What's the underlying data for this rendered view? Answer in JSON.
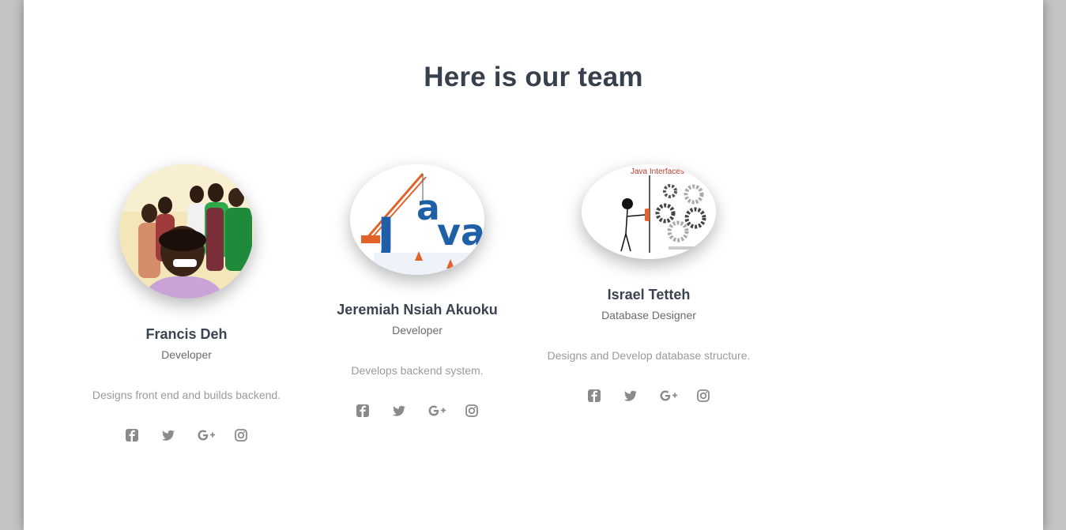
{
  "section": {
    "title": "Here is our team"
  },
  "team": [
    {
      "name": "Francis Deh",
      "role": "Developer",
      "description": "Designs front end and builds backend.",
      "photo": "group-photo"
    },
    {
      "name": "Jeremiah Nsiah Akuoku",
      "role": "Developer",
      "description": "Develops backend system.",
      "photo": "java-logo-image"
    },
    {
      "name": "Israel Tetteh",
      "role": "Database Designer",
      "description": "Designs and Develop database structure.",
      "photo": "java-interfaces-image",
      "photo_caption": "Java Interfaces"
    }
  ],
  "social_icons": [
    "facebook-icon",
    "twitter-icon",
    "google-plus-icon",
    "instagram-icon"
  ],
  "colors": {
    "heading": "#37414e",
    "icon": "#8a8a8a",
    "java_blue": "#1f5fa8",
    "java_orange": "#e0632a"
  }
}
